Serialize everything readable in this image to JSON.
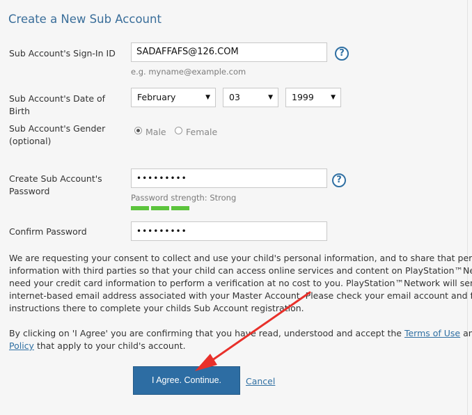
{
  "page": {
    "title": "Create a New Sub Account"
  },
  "form": {
    "signin": {
      "label": "Sub Account's Sign-In ID",
      "value": "SADAFFAFS@126.COM",
      "hint": "e.g. myname@example.com",
      "help": "?"
    },
    "dob": {
      "label_line1": "Sub Account's Date of",
      "label_line2": "Birth",
      "month": "February",
      "day": "03",
      "year": "1999"
    },
    "gender": {
      "label_line1": "Sub Account's Gender",
      "label_line2": "(optional)",
      "options": [
        "Male",
        "Female"
      ],
      "selected": "Male"
    },
    "password": {
      "label_line1": "Create Sub Account's",
      "label_line2": "Password",
      "value": "•••••••••",
      "help": "?",
      "strength_text": "Password strength: Strong",
      "strength_level": 3
    },
    "confirm": {
      "label": "Confirm Password",
      "value": "•••••••••"
    }
  },
  "consent": {
    "lines": [
      "We are requesting your consent to collect and use your child's personal information, and to share that personal",
      "information with third parties so that your child can access online services and content on PlayStation™Network.",
      "need your credit card information to perform a verification at no cost to you. PlayStation™Network will send an e",
      "internet-based email address associated with your Master Account. Please check your email account and follow t",
      "instructions there to complete your childs Sub Account registration."
    ]
  },
  "agreement": {
    "prefix": "By clicking on 'I Agree' you are confirming that you have read, understood and accept the ",
    "terms_link": "Terms of Use",
    "middle": " and the ",
    "privacy_link_part1": "P",
    "privacy_link_part2": "Policy",
    "suffix": " that apply to your child's account."
  },
  "actions": {
    "agree_label": "I Agree. Continue.",
    "cancel_label": "Cancel"
  },
  "colors": {
    "accent": "#2d6da3",
    "title": "#3a6e9a",
    "strength": "#5cc43c",
    "annotation_arrow": "#e8302a"
  }
}
